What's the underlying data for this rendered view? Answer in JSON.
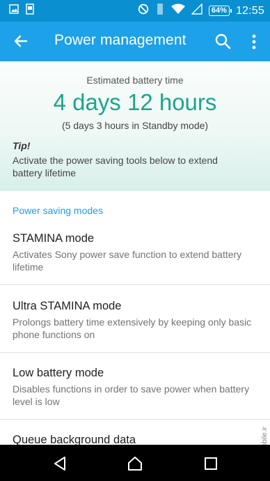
{
  "status": {
    "time": "12:55",
    "battery": "64%"
  },
  "appbar": {
    "title": "Power management"
  },
  "hero": {
    "estimated_label": "Estimated battery time",
    "estimate": "4 days 12 hours",
    "standby": "(5 days 3 hours in Standby mode)",
    "tip_title": "Tip!",
    "tip_body": "Activate the power saving tools below to extend battery lifetime"
  },
  "section": {
    "title": "Power saving modes"
  },
  "items": [
    {
      "title": "STAMINA mode",
      "subtitle": "Activates Sony power save function to extend battery lifetime"
    },
    {
      "title": "Ultra STAMINA mode",
      "subtitle": "Prolongs battery time extensively by keeping only basic phone functions on"
    },
    {
      "title": "Low battery mode",
      "subtitle": "Disables functions in order to save power when battery level is low"
    },
    {
      "title": "Queue background data",
      "subtitle": ""
    }
  ],
  "watermark": "mobile.ir",
  "colors": {
    "statusbar": "#0a8fd1",
    "appbar": "#1da1e8",
    "accent": "#1da58a",
    "section": "#1ca0e0"
  }
}
